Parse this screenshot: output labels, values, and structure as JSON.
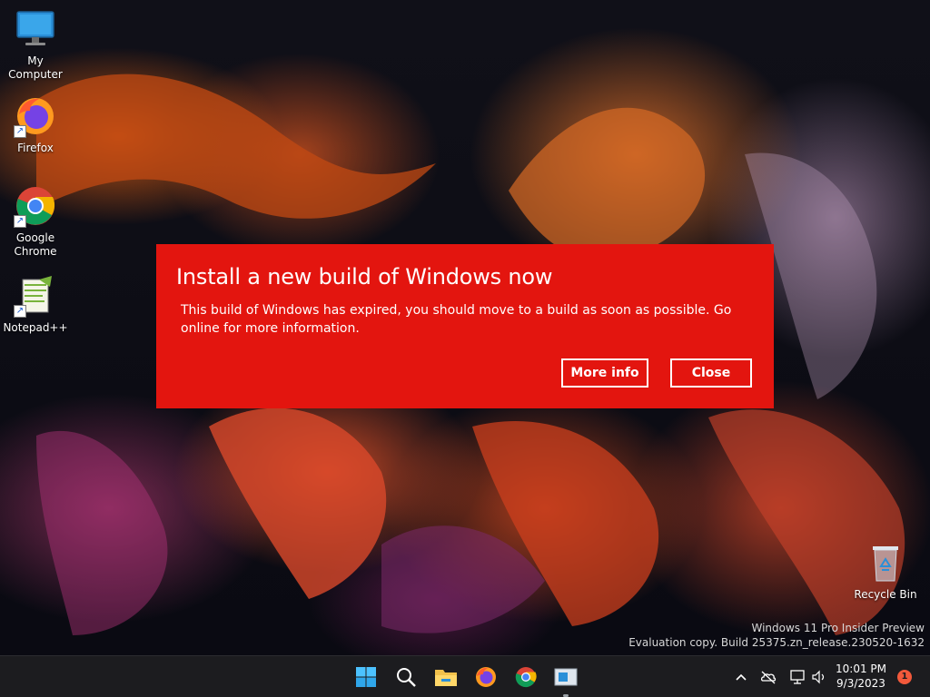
{
  "desktop": {
    "icons": [
      {
        "label": "My Computer",
        "icon": "monitor-icon"
      },
      {
        "label": "Firefox",
        "icon": "firefox-icon"
      },
      {
        "label": "Google\nChrome",
        "icon": "chrome-icon"
      },
      {
        "label": "Notepad++",
        "icon": "notepadpp-icon"
      },
      {
        "label": "Recycle Bin",
        "icon": "recycle-bin-icon"
      }
    ]
  },
  "dialog": {
    "title": "Install a new build of Windows now",
    "message": "This build of Windows has expired, you should move to a build as soon as possible. Go online for more information.",
    "more_info_label": "More info",
    "close_label": "Close",
    "bg_color": "#e3150f"
  },
  "watermark": {
    "line1": "Windows 11 Pro Insider Preview",
    "line2": "Evaluation copy. Build 25375.zn_release.230520-1632"
  },
  "taskbar": {
    "apps": [
      "start-icon",
      "search-icon",
      "file-explorer-icon",
      "firefox-icon",
      "chrome-icon",
      "app-window-icon"
    ],
    "time": "10:01 PM",
    "date": "9/3/2023",
    "notification_count": "1"
  }
}
